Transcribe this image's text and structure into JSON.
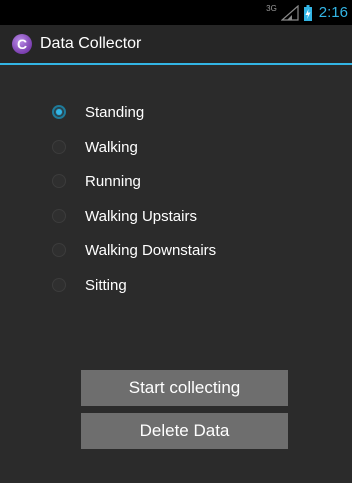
{
  "status_bar": {
    "network_type": "3G",
    "time": "2:16",
    "signal_icon": "signal-strength-icon",
    "battery_icon": "battery-icon"
  },
  "action_bar": {
    "app_icon": "app-logo-icon",
    "app_icon_letter": "C",
    "title": "Data Collector"
  },
  "activities": {
    "selected": "Standing",
    "options": [
      {
        "label": "Standing",
        "checked": true
      },
      {
        "label": "Walking",
        "checked": false
      },
      {
        "label": "Running",
        "checked": false
      },
      {
        "label": "Walking Upstairs",
        "checked": false
      },
      {
        "label": "Walking Downstairs",
        "checked": false
      },
      {
        "label": "Sitting",
        "checked": false
      }
    ]
  },
  "buttons": {
    "start_label": "Start collecting",
    "delete_label": "Delete Data"
  },
  "colors": {
    "accent": "#33b5e5",
    "background": "#2b2b2b",
    "button": "#6e6e6e"
  }
}
